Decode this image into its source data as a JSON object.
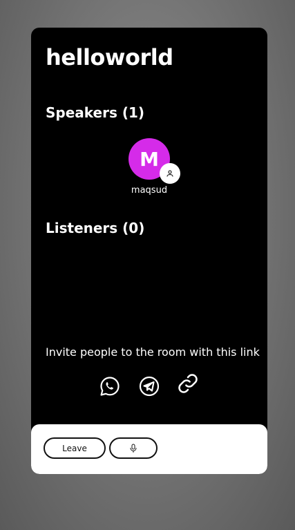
{
  "room": {
    "title": "helloworld"
  },
  "speakers": {
    "heading": "Speakers (1)",
    "items": [
      {
        "initial": "M",
        "name": "maqsud",
        "avatar_color": "#d52be9",
        "badge_icon": "person-icon"
      }
    ]
  },
  "listeners": {
    "heading": "Listeners (0)",
    "items": []
  },
  "invite": {
    "text": "Invite people to the room with this link",
    "share_icons": [
      "whatsapp-icon",
      "telegram-icon",
      "link-icon"
    ]
  },
  "controls": {
    "leave_label": "Leave",
    "mic_icon": "microphone-icon"
  },
  "colors": {
    "card_bg": "#000000",
    "controls_bg": "#ffffff",
    "avatar": "#d52be9"
  }
}
